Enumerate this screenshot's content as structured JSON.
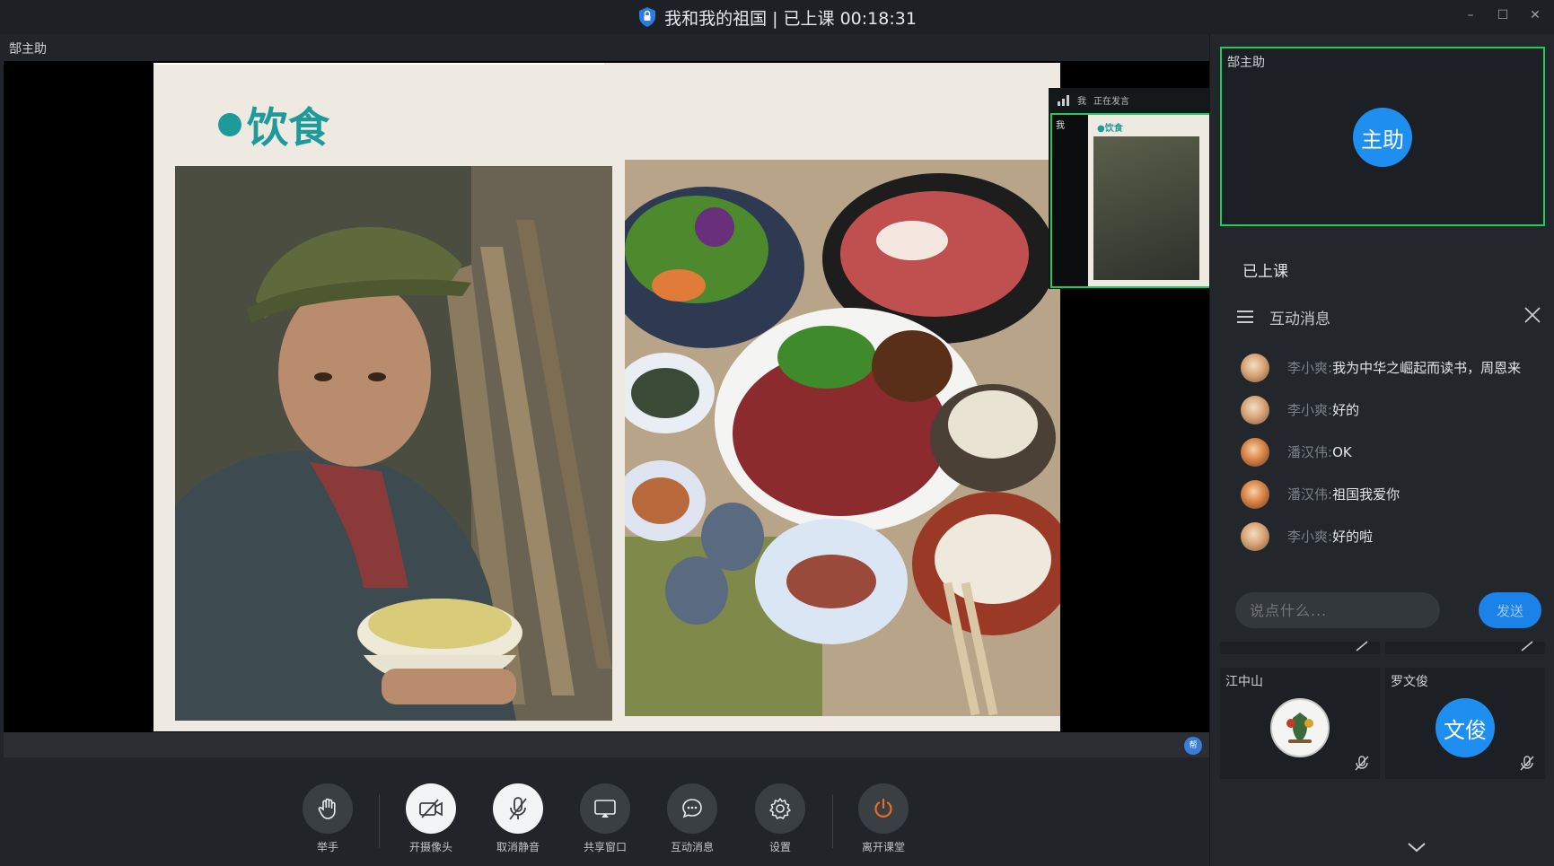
{
  "window": {
    "title": "我和我的祖国 | 已上课 00:18:31",
    "controls": {
      "minimize": "–",
      "maximize": "☐",
      "close": "✕"
    }
  },
  "stage": {
    "owner_label": "郜主助",
    "slide": {
      "heading": "饮食"
    },
    "thumbnail": {
      "label": "我",
      "speaking": "正在发言",
      "mini_heading": "●饮食"
    },
    "strip_badge": "帮"
  },
  "toolbar": {
    "items": [
      {
        "label": "举手",
        "icon": "raise-hand-icon"
      },
      {
        "label": "开摄像头",
        "icon": "camera-off-icon"
      },
      {
        "label": "取消静音",
        "icon": "mic-off-icon"
      },
      {
        "label": "共享窗口",
        "icon": "screen-share-icon"
      },
      {
        "label": "互动消息",
        "icon": "chat-bubble-icon"
      },
      {
        "label": "设置",
        "icon": "gear-icon"
      },
      {
        "label": "离开课堂",
        "icon": "power-icon"
      }
    ]
  },
  "sidebar": {
    "host_tile": {
      "name": "郜主助",
      "avatar_text": "主助"
    },
    "class_status": "已上课",
    "chat": {
      "title": "互动消息",
      "messages": [
        {
          "sender": "李小爽:",
          "text": "我为中华之崛起而读书，周恩来"
        },
        {
          "sender": "李小爽:",
          "text": "好的"
        },
        {
          "sender": "潘汉伟:",
          "text": "OK"
        },
        {
          "sender": "潘汉伟:",
          "text": "祖国我爱你"
        },
        {
          "sender": "李小爽:",
          "text": "好的啦"
        }
      ],
      "input_placeholder": "说点什么...",
      "send_label": "发送"
    },
    "participants": [
      {
        "name": "江中山",
        "avatar": "emblem"
      },
      {
        "name": "罗文俊",
        "avatar_text": "文俊"
      }
    ]
  },
  "colors": {
    "accent_green": "#1fc95a",
    "avatar_blue": "#1e8ff0",
    "slide_teal": "#1e9a9a",
    "leave_orange": "#f06a2a"
  }
}
